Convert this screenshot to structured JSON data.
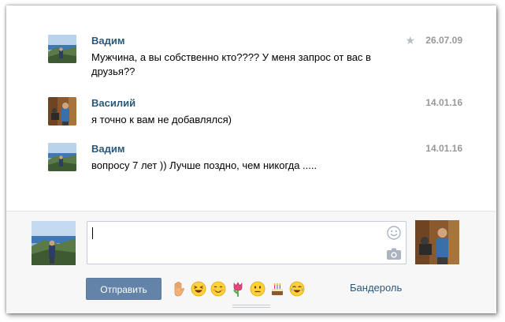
{
  "messages": [
    {
      "author": "Вадим",
      "date": "26.07.09",
      "starred": true,
      "lines": [
        "Мужчина, а вы собственно кто???? У меня запрос от вас в",
        "друзья??"
      ],
      "avatar": "landscape-photo"
    },
    {
      "author": "Василий",
      "date": "14.01.16",
      "starred": false,
      "lines": [
        "я точно к вам не добавлялся)"
      ],
      "avatar": "portrait-photo"
    },
    {
      "author": "Вадим",
      "date": "14.01.16",
      "starred": false,
      "lines": [
        "вопросу 7 лет )) Лучше поздно, чем никогда ....."
      ],
      "avatar": "landscape-photo"
    }
  ],
  "composer": {
    "input_value": "",
    "send_label": "Отправить",
    "parcel_label": "Бандероль",
    "emojis": [
      "raised-hand-emoji",
      "laughing-emoji",
      "blushing-emoji",
      "tulip-emoji",
      "neutral-face-emoji",
      "birthday-cake-emoji",
      "crying-laughing-emoji"
    ],
    "icons": [
      "smile-icon",
      "camera-icon"
    ]
  },
  "colors": {
    "author": "#2b587a",
    "date": "#999999",
    "send_button": "#6383a8",
    "composer_bg": "#f7f7f8"
  }
}
